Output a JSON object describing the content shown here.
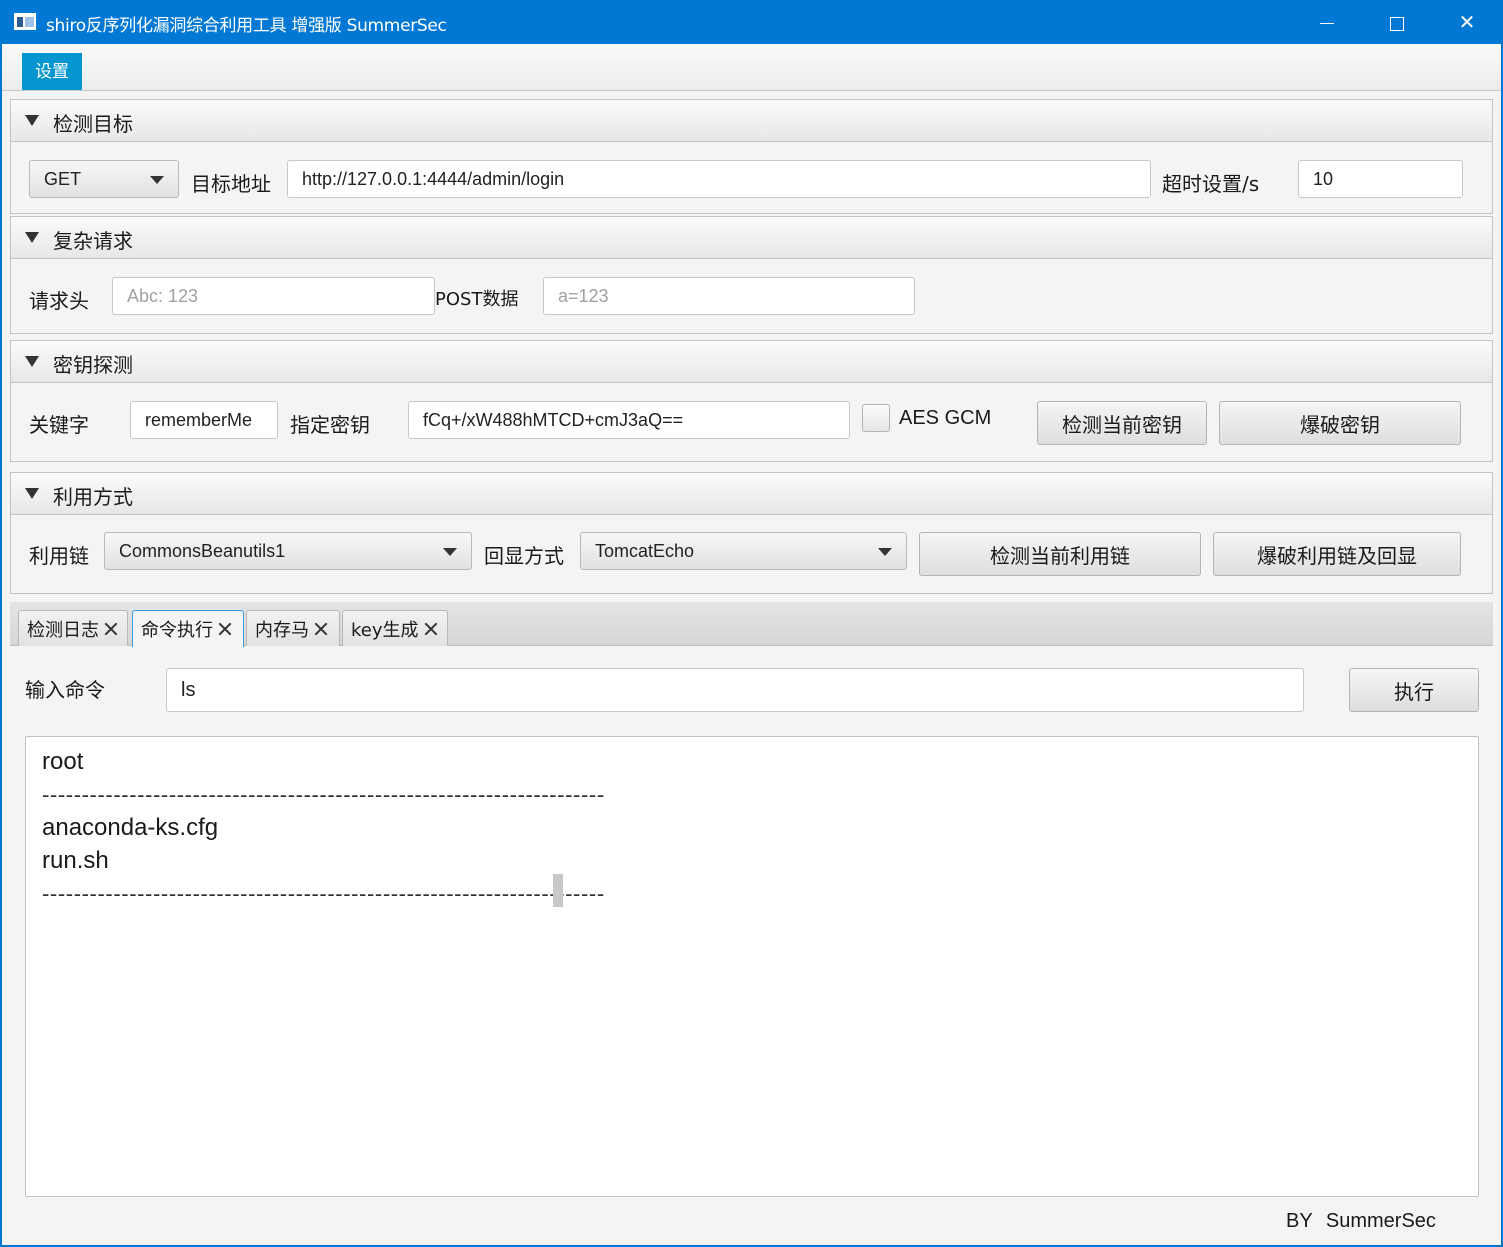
{
  "window": {
    "title": "shiro反序列化漏洞综合利用工具 增强版 SummerSec",
    "app_icon": "app-window-icon",
    "controls": [
      "minimize-icon",
      "maximize-icon",
      "close-icon"
    ]
  },
  "menu": {
    "settings_label": "设置"
  },
  "panes": {
    "target": {
      "title": "检测目标",
      "method": "GET",
      "url_label": "目标地址",
      "url_value": "http://127.0.0.1:4444/admin/login",
      "timeout_label": "超时设置/s",
      "timeout_value": "10"
    },
    "complex": {
      "title": "复杂请求",
      "headers_label": "请求头",
      "headers_placeholder": "Abc: 123",
      "post_label": "POST数据",
      "post_placeholder": "a=123"
    },
    "key": {
      "title": "密钥探测",
      "keyword_label": "关键字",
      "keyword_value": "rememberMe",
      "key_label": "指定密钥",
      "key_value": "fCq+/xW488hMTCD+cmJ3aQ==",
      "aes_gcm_label": "AES GCM",
      "aes_gcm_checked": false,
      "check_key_button": "检测当前密钥",
      "brute_key_button": "爆破密钥"
    },
    "exploit": {
      "title": "利用方式",
      "chain_label": "利用链",
      "chain_value": "CommonsBeanutils1",
      "echo_label": "回显方式",
      "echo_value": "TomcatEcho",
      "check_chain_button": "检测当前利用链",
      "brute_chain_button": "爆破利用链及回显"
    }
  },
  "tabs": [
    {
      "label": "检测日志",
      "active": false
    },
    {
      "label": "命令执行",
      "active": true
    },
    {
      "label": "内存马",
      "active": false
    },
    {
      "label": "key生成",
      "active": false
    }
  ],
  "command": {
    "label": "输入命令",
    "value": "ls",
    "execute_button": "执行"
  },
  "output_lines": [
    "root",
    "-----------------------------------------------------------------------",
    "anaconda-ks.cfg",
    "run.sh",
    "-----------------------------------------------------------------------"
  ],
  "footer": "BY  SummerSec",
  "colors": {
    "title_bar": "#0078d4",
    "menu_active": "#0596cf",
    "background": "#f4f4f4",
    "tab_active_border": "#3f9be0"
  }
}
